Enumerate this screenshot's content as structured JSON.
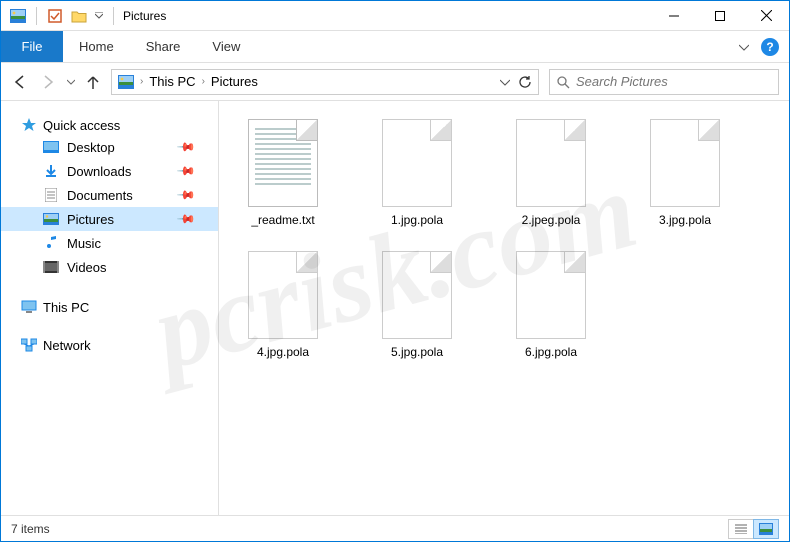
{
  "window": {
    "title": "Pictures"
  },
  "ribbon": {
    "file": "File",
    "tabs": [
      "Home",
      "Share",
      "View"
    ]
  },
  "breadcrumb": {
    "items": [
      "This PC",
      "Pictures"
    ]
  },
  "search": {
    "placeholder": "Search Pictures"
  },
  "nav": {
    "quick_access": {
      "label": "Quick access",
      "items": [
        {
          "label": "Desktop",
          "pinned": true,
          "icon": "desktop"
        },
        {
          "label": "Downloads",
          "pinned": true,
          "icon": "downloads"
        },
        {
          "label": "Documents",
          "pinned": true,
          "icon": "documents"
        },
        {
          "label": "Pictures",
          "pinned": true,
          "icon": "pictures",
          "selected": true
        },
        {
          "label": "Music",
          "pinned": false,
          "icon": "music"
        },
        {
          "label": "Videos",
          "pinned": false,
          "icon": "videos"
        }
      ]
    },
    "this_pc": {
      "label": "This PC"
    },
    "network": {
      "label": "Network"
    }
  },
  "files": [
    {
      "name": "_readme.txt",
      "type": "txt"
    },
    {
      "name": "1.jpg.pola",
      "type": "blank"
    },
    {
      "name": "2.jpeg.pola",
      "type": "blank"
    },
    {
      "name": "3.jpg.pola",
      "type": "blank"
    },
    {
      "name": "4.jpg.pola",
      "type": "blank"
    },
    {
      "name": "5.jpg.pola",
      "type": "blank"
    },
    {
      "name": "6.jpg.pola",
      "type": "blank"
    }
  ],
  "status": {
    "count": "7 items"
  },
  "watermark": "pcrisk.com"
}
